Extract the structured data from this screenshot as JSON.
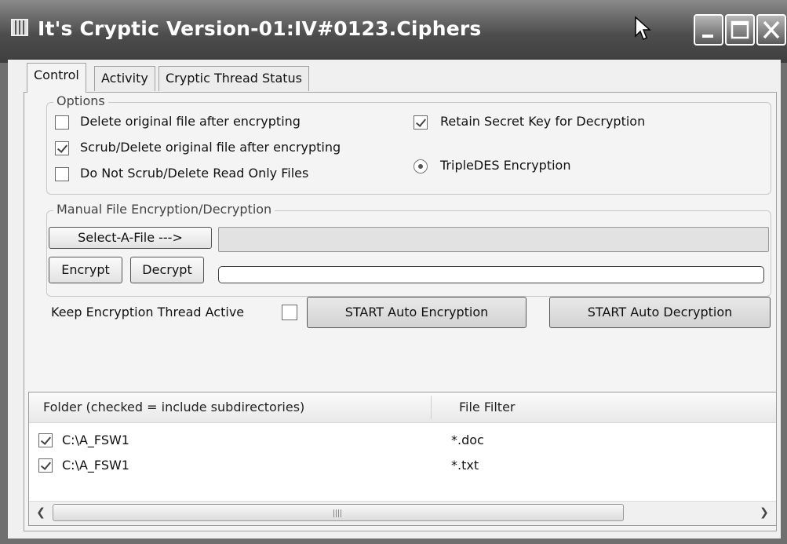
{
  "window": {
    "title": "It's Cryptic Version-01:IV#0123.Ciphers"
  },
  "tabs": [
    {
      "label": "Control",
      "active": true
    },
    {
      "label": "Activity",
      "active": false
    },
    {
      "label": "Cryptic Thread Status",
      "active": false
    }
  ],
  "options": {
    "legend": "Options",
    "delete_original": {
      "label": "Delete original file after encrypting",
      "checked": false
    },
    "scrub_delete": {
      "label": "Scrub/Delete original file after encrypting",
      "checked": true
    },
    "no_scrub_readonly": {
      "label": "Do Not Scrub/Delete Read Only Files",
      "checked": false
    },
    "retain_key": {
      "label": "Retain Secret Key for Decryption",
      "checked": true
    },
    "tripledes": {
      "label": "TripleDES Encryption",
      "selected": true
    }
  },
  "manual": {
    "legend": "Manual File Encryption/Decryption",
    "select_file_label": "Select-A-File --->",
    "file_path_value": "",
    "encrypt_label": "Encrypt",
    "decrypt_label": "Decrypt",
    "progress_value": 0
  },
  "auto": {
    "keep_thread_label": "Keep Encryption Thread Active",
    "keep_thread_checked": false,
    "start_encryption_label": "START Auto Encryption",
    "start_decryption_label": "START Auto Decryption"
  },
  "folders": {
    "columns": [
      "Folder (checked = include subdirectories)",
      "File Filter"
    ],
    "rows": [
      {
        "folder": "C:\\A_FSW1",
        "filter": "*.doc",
        "checked": true
      },
      {
        "folder": "C:\\A_FSW1",
        "filter": "*.txt",
        "checked": true
      }
    ]
  },
  "icons": {
    "app": "app-icon",
    "cursor": "cursor-icon",
    "minimize": "minimize-icon",
    "maximize": "maximize-icon",
    "close": "close-icon",
    "scroll_left": "chevron-left-icon",
    "scroll_right": "chevron-right-icon"
  }
}
